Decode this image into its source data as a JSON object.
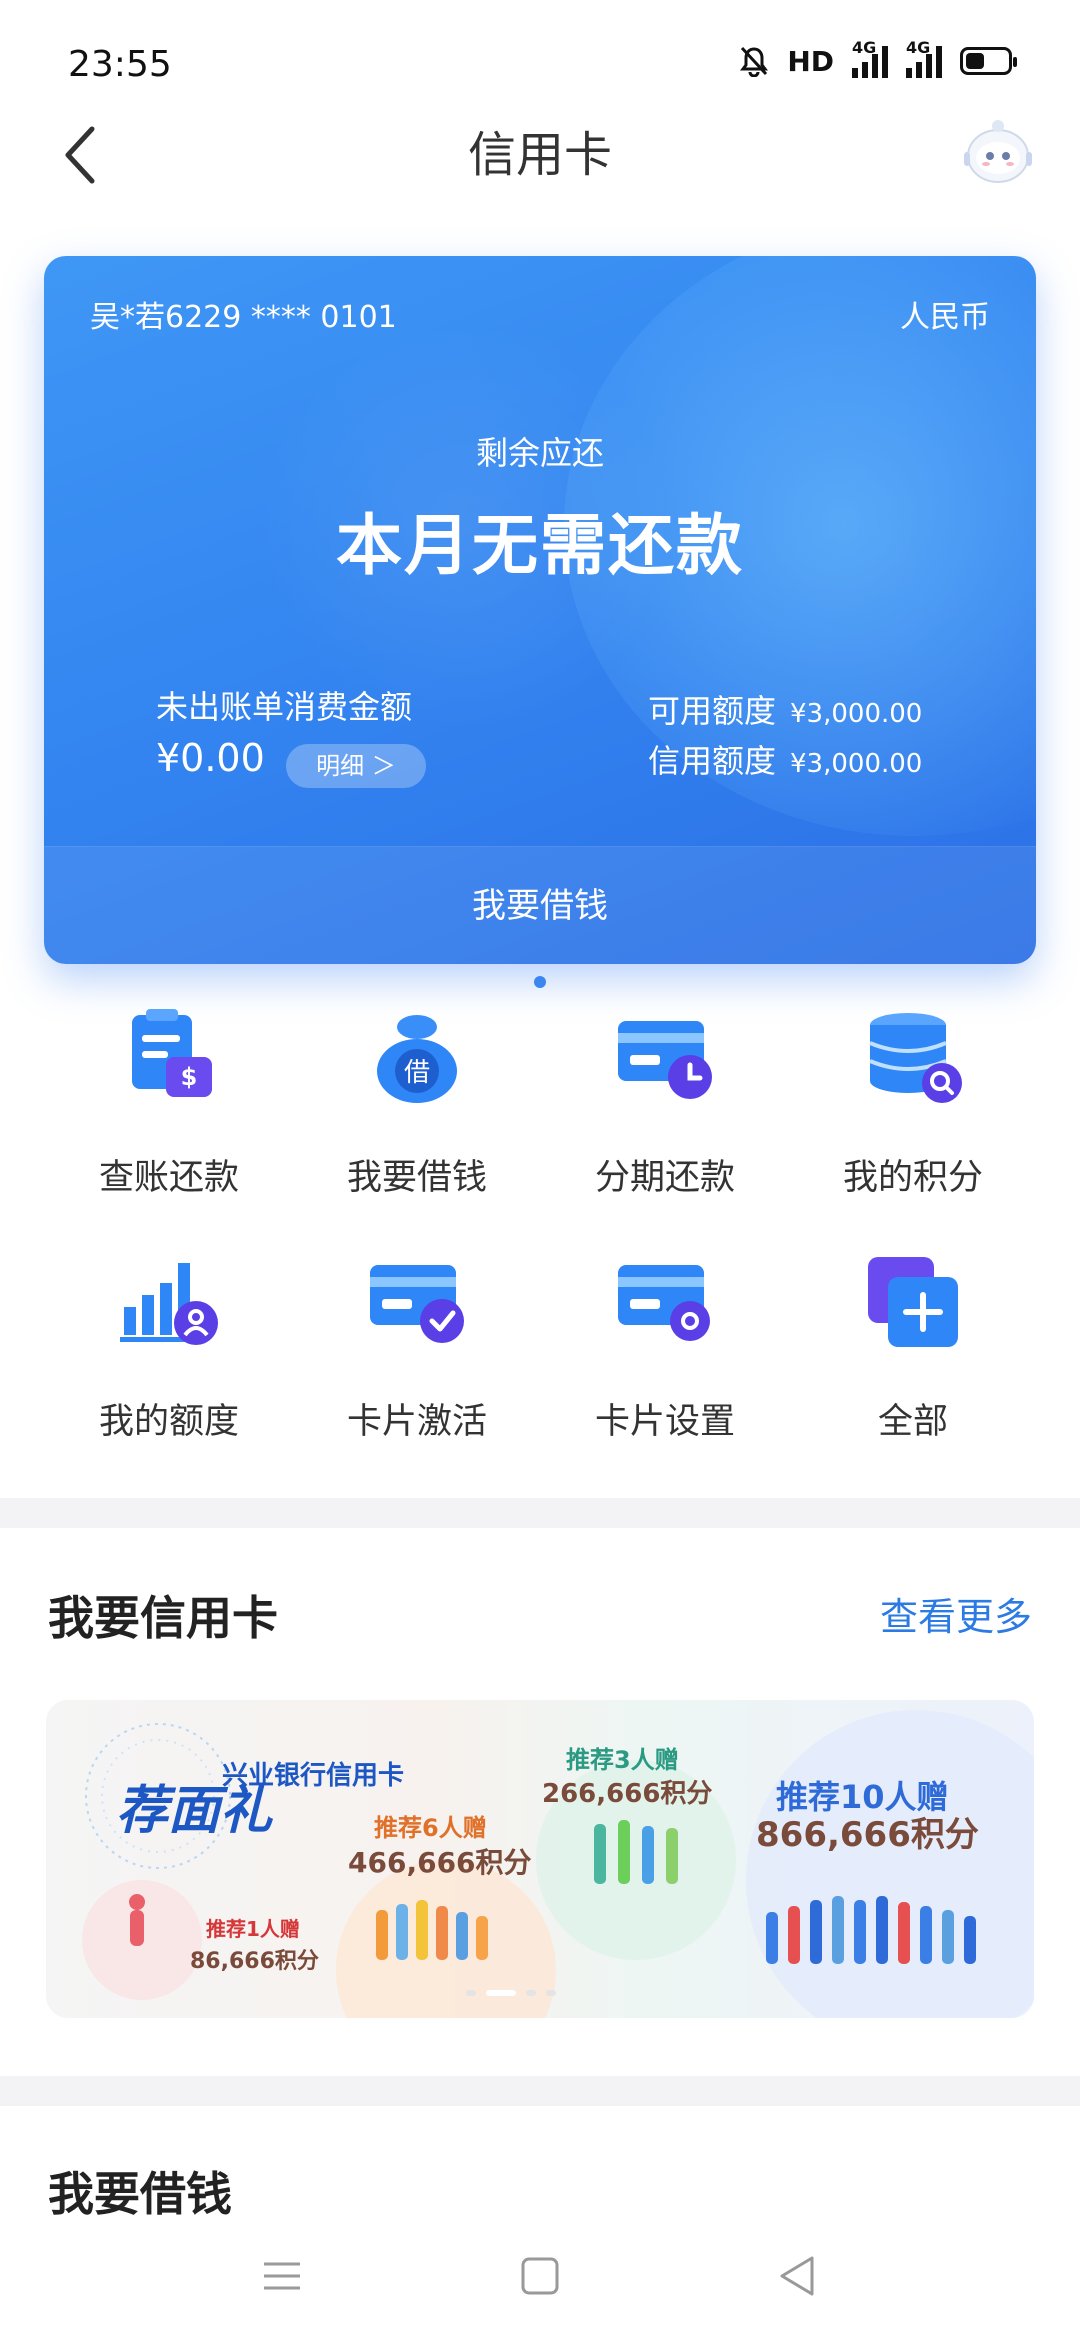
{
  "status_bar": {
    "time": "23:55",
    "hd": "HD",
    "net1": "4G",
    "net2": "4G",
    "battery_level": 0.4
  },
  "header": {
    "title": "信用卡",
    "back_icon": "chevron-left-icon",
    "assistant_icon": "robot-assistant-icon"
  },
  "card": {
    "number": "吴*若6229 **** 0101",
    "currency": "人民币",
    "remain_label": "剩余应还",
    "remain_value": "本月无需还款",
    "unbilled_label": "未出账单消费金额",
    "unbilled_value": "¥0.00",
    "detail_label": "明细 ＞",
    "available_label": "可用额度",
    "available_value": "¥3,000.00",
    "limit_label": "信用额度",
    "limit_value": "¥3,000.00",
    "footer_label": "我要借钱"
  },
  "quick_actions": [
    {
      "label": "查账还款",
      "icon": "bill-pay-icon"
    },
    {
      "label": "我要借钱",
      "icon": "loan-bag-icon"
    },
    {
      "label": "分期还款",
      "icon": "installment-card-icon"
    },
    {
      "label": "我的积分",
      "icon": "points-database-icon"
    },
    {
      "label": "我的额度",
      "icon": "credit-limit-icon"
    },
    {
      "label": "卡片激活",
      "icon": "card-activate-icon"
    },
    {
      "label": "卡片设置",
      "icon": "card-settings-icon"
    },
    {
      "label": "全部",
      "icon": "all-plus-icon"
    }
  ],
  "section_cards": {
    "title": "我要信用卡",
    "more": "查看更多"
  },
  "banner": {
    "brand_line": "兴业银行信用卡",
    "brand_title": "荐面礼",
    "tier1": {
      "headline": "推荐1人赠",
      "points": "86,666积分"
    },
    "tier2": {
      "headline": "推荐6人赠",
      "points": "466,666积分"
    },
    "tier3": {
      "headline": "推荐3人赠",
      "points": "266,666积分"
    },
    "tier4": {
      "headline": "推荐10人赠",
      "points": "866,666积分"
    }
  },
  "section_loan": {
    "title": "我要借钱"
  },
  "nav": {
    "menu": "menu-icon",
    "home": "home-square-icon",
    "back": "back-triangle-icon"
  },
  "colors": {
    "accent": "#2c7be5",
    "card_blue": "#3384f0"
  }
}
